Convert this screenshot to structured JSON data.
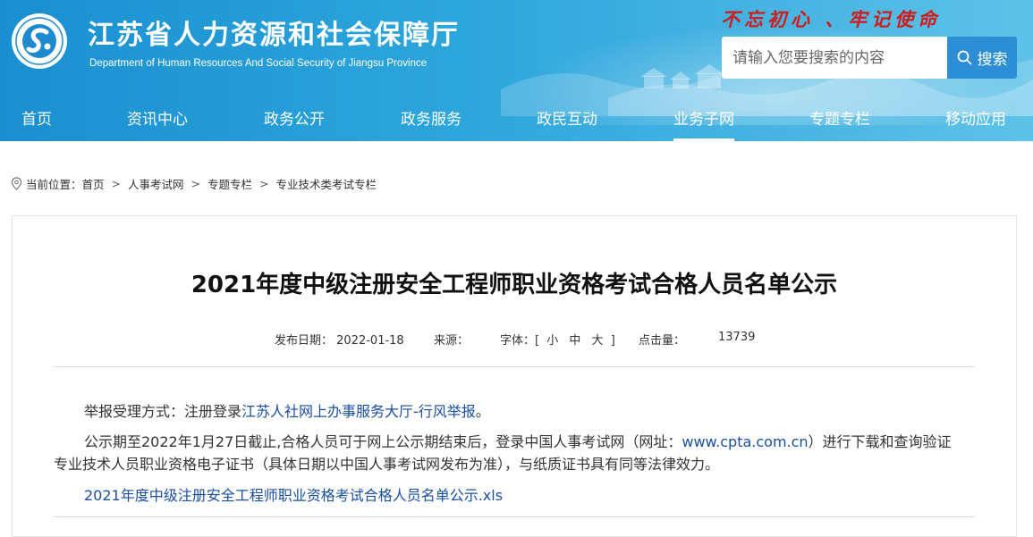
{
  "header": {
    "title": "江苏省人力资源和社会保障厅",
    "subtitle": "Department of Human Resources And Social Security of Jiangsu Province",
    "slogan": "不忘初心 、牢记使命",
    "colors": {
      "header_start": "#1a8fd0",
      "header_end": "#5ec2e8",
      "slogan": "#d21a1a",
      "search_button": "#2c8fd6"
    }
  },
  "search": {
    "placeholder": "请输入您要搜索的内容",
    "button_label": "搜索",
    "icon": "search-icon"
  },
  "nav": {
    "items": [
      {
        "label": "首页"
      },
      {
        "label": "资讯中心"
      },
      {
        "label": "政务公开"
      },
      {
        "label": "政务服务"
      },
      {
        "label": "政民互动"
      },
      {
        "label": "业务子网",
        "active": true
      },
      {
        "label": "专题专栏"
      },
      {
        "label": "移动应用"
      }
    ]
  },
  "breadcrumb": {
    "icon": "location-pin-icon",
    "prefix": "当前位置：",
    "items": [
      "首页",
      "人事考试网",
      "专题专栏",
      "专业技术类考试专栏"
    ],
    "separator": ">"
  },
  "article": {
    "title": "2021年度中级注册安全工程师职业资格考试合格人员名单公示",
    "meta": {
      "date_label": "发布日期：",
      "date": "2022-01-18",
      "source_label": "来源：",
      "font_label": "字体：[",
      "font_small": "小",
      "font_medium": "中",
      "font_large": "大",
      "font_close": "]",
      "clicks_label": "点击量：",
      "clicks": "13739"
    },
    "p1_prefix": "举报受理方式：注册登录",
    "p1_link": "江苏人社网上办事服务大厅-行风举报",
    "p1_suffix": "。",
    "p2_line1_prefix": "公示期至2022年1月27日截止,合格人员可于网上公示期结束后，登录中国人事考试网（网址：",
    "p2_url": "www.cpta.com.cn",
    "p2_line1_suffix": "）进行下载和查询验证",
    "p2_line2": "专业技术人员职业资格电子证书（具体日期以中国人事考试网发布为准），与纸质证书具有同等法律效力。",
    "attachment": "2021年度中级注册安全工程师职业资格考试合格人员名单公示.xls"
  }
}
